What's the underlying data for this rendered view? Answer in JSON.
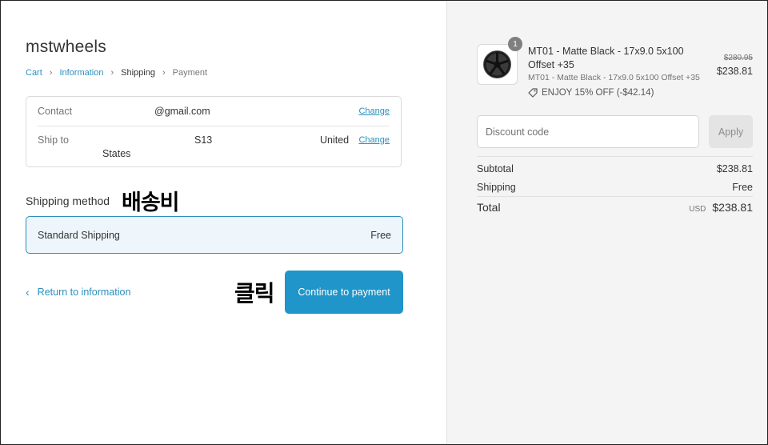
{
  "shop": {
    "name": "mstwheels"
  },
  "breadcrumb": {
    "cart": "Cart",
    "information": "Information",
    "shipping": "Shipping",
    "payment": "Payment"
  },
  "review": {
    "contact_label": "Contact",
    "contact_value": "@gmail.com",
    "shipto_label": "Ship to",
    "shipto_part1": "S13",
    "shipto_part2": "United",
    "shipto_part3": "States",
    "change_label": "Change"
  },
  "shipping_method": {
    "title": "Shipping method",
    "option_label": "Standard Shipping",
    "option_price": "Free"
  },
  "annotations": {
    "shipping_fee": "배송비",
    "click": "클릭"
  },
  "actions": {
    "return_label": "Return to information",
    "continue_label": "Continue to payment"
  },
  "order": {
    "quantity": "1",
    "product_title": "MT01 - Matte Black - 17x9.0 5x100 Offset +35",
    "product_variant": "MT01 - Matte Black - 17x9.0 5x100 Offset +35",
    "discount_note": "ENJOY 15% OFF (-$42.14)",
    "price_original": "$280.95",
    "price_now": "$238.81",
    "discount_placeholder": "Discount code",
    "apply_label": "Apply",
    "subtotal_label": "Subtotal",
    "subtotal_value": "$238.81",
    "shipping_label": "Shipping",
    "shipping_value": "Free",
    "total_label": "Total",
    "total_currency": "USD",
    "total_value": "$238.81"
  },
  "colors": {
    "accent": "#1f95c9",
    "link": "#2a8fbd",
    "sidebar_bg": "#f4f4f4"
  }
}
